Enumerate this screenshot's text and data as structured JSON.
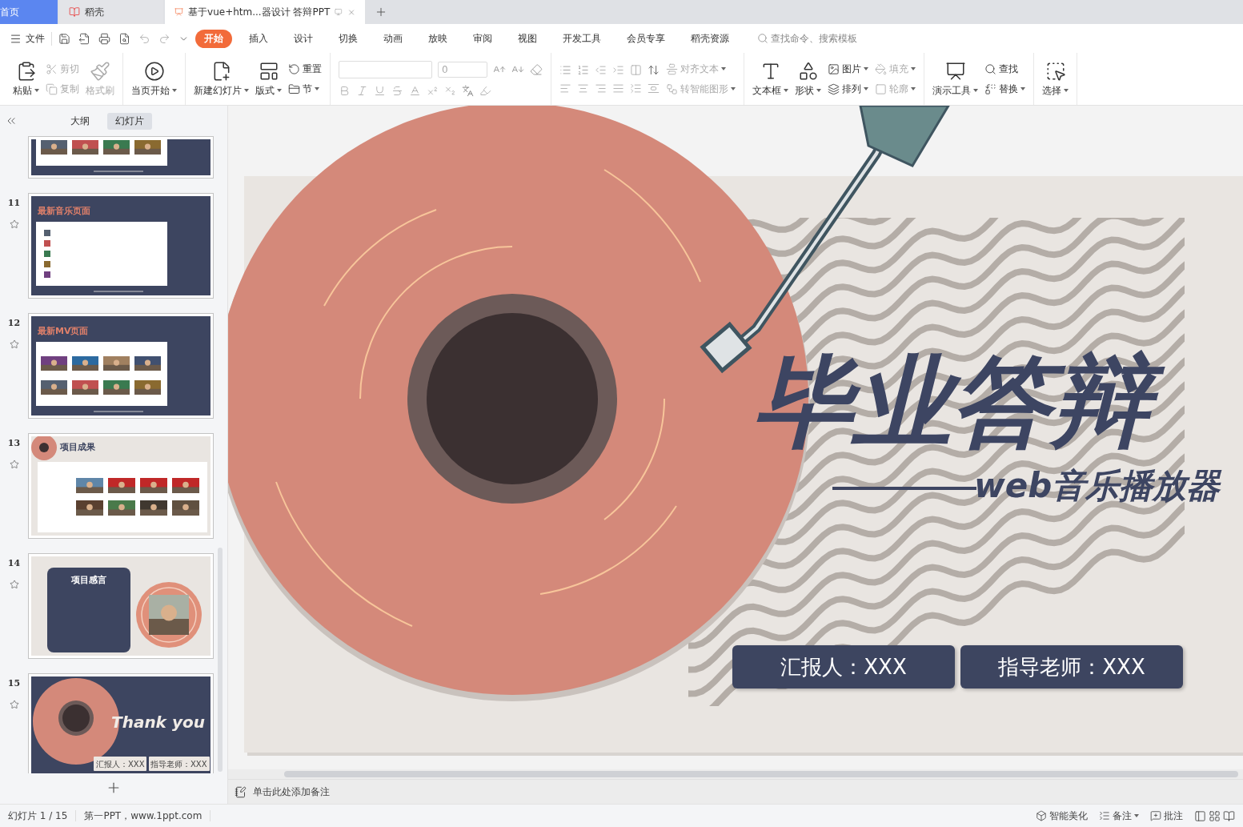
{
  "tabs": [
    {
      "label": "首页",
      "kind": "home",
      "selected": false
    },
    {
      "label": "稻壳",
      "kind": "app",
      "selected": false
    },
    {
      "label": "基于vue+htm...器设计 答辩PPT",
      "kind": "doc",
      "selected": true
    }
  ],
  "menu": {
    "file": "文件",
    "tabs": [
      {
        "label": "开始",
        "selected": true
      },
      {
        "label": "插入",
        "selected": false
      },
      {
        "label": "设计",
        "selected": false
      },
      {
        "label": "切换",
        "selected": false
      },
      {
        "label": "动画",
        "selected": false
      },
      {
        "label": "放映",
        "selected": false
      },
      {
        "label": "审阅",
        "selected": false
      },
      {
        "label": "视图",
        "selected": false
      },
      {
        "label": "开发工具",
        "selected": false
      },
      {
        "label": "会员专享",
        "selected": false
      },
      {
        "label": "稻壳资源",
        "selected": false
      }
    ],
    "search_placeholder": "查找命令、搜索模板"
  },
  "ribbon": [
    {
      "items": [
        {
          "kind": "large",
          "label": "粘贴",
          "dropdown": true,
          "disabled": false
        },
        {
          "kind": "stack",
          "items": [
            {
              "label": "剪切",
              "dropdown": false,
              "disabled": true
            },
            {
              "label": "复制",
              "dropdown": false,
              "disabled": true
            }
          ]
        },
        {
          "kind": "large",
          "label": "格式刷",
          "dropdown": false,
          "disabled": true
        }
      ]
    },
    {
      "items": [
        {
          "kind": "large",
          "label": "当页开始",
          "dropdown": true,
          "disabled": false
        }
      ]
    },
    {
      "items": [
        {
          "kind": "large",
          "label": "新建幻灯片",
          "dropdown": true,
          "disabled": false
        },
        {
          "kind": "large",
          "label": "版式",
          "dropdown": true,
          "disabled": false
        },
        {
          "kind": "stack",
          "items": [
            {
              "label": "重置",
              "dropdown": false,
              "disabled": false
            },
            {
              "label": "节",
              "dropdown": true,
              "disabled": false
            }
          ]
        }
      ]
    },
    {
      "items": [
        {
          "kind": "font",
          "size": "0"
        }
      ]
    },
    {
      "items": [
        {
          "kind": "paragraph",
          "items": [
            {
              "label": "对齐文本",
              "dropdown": true,
              "disabled": true
            },
            {
              "label": "转智能图形",
              "dropdown": true,
              "disabled": true
            }
          ]
        }
      ]
    },
    {
      "items": [
        {
          "kind": "large",
          "label": "文本框",
          "dropdown": true,
          "disabled": false
        },
        {
          "kind": "large",
          "label": "形状",
          "dropdown": true,
          "disabled": false
        },
        {
          "kind": "stack",
          "items": [
            {
              "label": "图片",
              "dropdown": true,
              "disabled": false
            },
            {
              "label": "排列",
              "dropdown": true,
              "disabled": false
            }
          ]
        },
        {
          "kind": "stack",
          "items": [
            {
              "label": "填充",
              "dropdown": true,
              "disabled": true
            },
            {
              "label": "轮廓",
              "dropdown": true,
              "disabled": true
            }
          ]
        }
      ]
    },
    {
      "items": [
        {
          "kind": "large",
          "label": "演示工具",
          "dropdown": true,
          "disabled": false
        },
        {
          "kind": "stack",
          "items": [
            {
              "label": "查找",
              "dropdown": false,
              "disabled": false
            },
            {
              "label": "替换",
              "dropdown": true,
              "disabled": false
            }
          ]
        }
      ]
    },
    {
      "items": [
        {
          "kind": "large",
          "label": "选择",
          "dropdown": true,
          "disabled": false
        }
      ]
    }
  ],
  "panel": {
    "tabs": [
      {
        "label": "大纲",
        "selected": false
      },
      {
        "label": "幻灯片",
        "selected": true
      }
    ],
    "slides": [
      {
        "kind": "gallery",
        "partial": true
      },
      {
        "kind": "list",
        "number": "11",
        "title": "最新音乐页面",
        "partial": false
      },
      {
        "kind": "gallery",
        "number": "12",
        "title": "最新MV页面",
        "partial": false
      },
      {
        "kind": "results",
        "number": "13",
        "title": "项目成果",
        "partial": false
      },
      {
        "kind": "note",
        "number": "14",
        "title": "项目感言",
        "partial": false
      },
      {
        "kind": "cover",
        "number": "15",
        "title": "Thank you",
        "reporter": "汇报人：XXX",
        "advisor": "指导老师：XXX",
        "partial": false
      }
    ]
  },
  "slide": {
    "title": "毕业答辩",
    "subtitle": "web音乐播放器",
    "reporter": "汇报人：XXX",
    "advisor": "指导老师：XXX"
  },
  "notes": {
    "placeholder": "单击此处添加备注"
  },
  "status_bar": {
    "slide": "幻灯片 1 / 15",
    "theme": "第一PPT，www.1ppt.com",
    "beautify": "智能美化",
    "notes": "备注",
    "comments": "批注"
  }
}
